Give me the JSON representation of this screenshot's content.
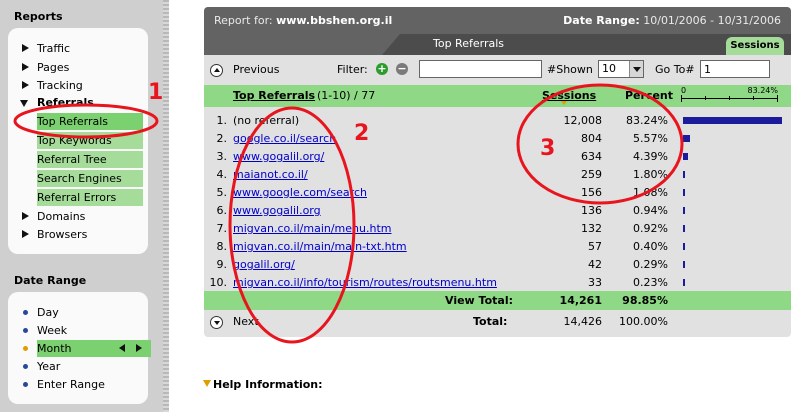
{
  "sidebar": {
    "reports_title": "Reports",
    "items": [
      {
        "label": "Traffic"
      },
      {
        "label": "Pages"
      },
      {
        "label": "Tracking"
      },
      {
        "label": "Referrals"
      },
      {
        "label": "Domains"
      },
      {
        "label": "Browsers"
      }
    ],
    "sub_items": [
      {
        "label": "Top Referrals"
      },
      {
        "label": "Top Keywords"
      },
      {
        "label": "Referral Tree"
      },
      {
        "label": "Search Engines"
      },
      {
        "label": "Referral Errors"
      }
    ],
    "date_range_title": "Date Range",
    "date_items": [
      {
        "label": "Day"
      },
      {
        "label": "Week"
      },
      {
        "label": "Month"
      },
      {
        "label": "Year"
      },
      {
        "label": "Enter Range"
      }
    ]
  },
  "report": {
    "report_for_label": "Report for:",
    "site": "www.bbshen.org.il",
    "date_range_label": "Date Range:",
    "date_range": "10/01/2006 - 10/31/2006",
    "tab_title": "Top Referrals",
    "sessions_tab": "Sessions"
  },
  "toolbar": {
    "previous": "Previous",
    "filter_label": "Filter:",
    "filter_value": "",
    "shown_label": "#Shown",
    "shown_value": "10",
    "goto_label": "Go To#",
    "goto_value": "1"
  },
  "table": {
    "col_referrals": "Top Referrals",
    "range_text": "(1-10) / 77",
    "col_sessions": "Sessions",
    "col_percent": "Percent",
    "scale_min": "0",
    "scale_max": "83.24%",
    "rows": [
      {
        "num": "1.",
        "referral": "(no referral)",
        "sessions": "12,008",
        "percent": "83.24%",
        "share": 0.8324
      },
      {
        "num": "2.",
        "referral": "google.co.il/search",
        "sessions": "804",
        "percent": "5.57%",
        "share": 0.0557
      },
      {
        "num": "3.",
        "referral": "www.gogalil.org/",
        "sessions": "634",
        "percent": "4.39%",
        "share": 0.0439
      },
      {
        "num": "4.",
        "referral": "maianot.co.il/",
        "sessions": "259",
        "percent": "1.80%",
        "share": 0.018
      },
      {
        "num": "5.",
        "referral": "www.google.com/search",
        "sessions": "156",
        "percent": "1.08%",
        "share": 0.0108
      },
      {
        "num": "6.",
        "referral": "www.gogalil.org",
        "sessions": "136",
        "percent": "0.94%",
        "share": 0.0094
      },
      {
        "num": "7.",
        "referral": "migvan.co.il/main/menu.htm",
        "sessions": "132",
        "percent": "0.92%",
        "share": 0.0092
      },
      {
        "num": "8.",
        "referral": "migvan.co.il/main/main-txt.htm",
        "sessions": "57",
        "percent": "0.40%",
        "share": 0.004
      },
      {
        "num": "9.",
        "referral": "gogalil.org/",
        "sessions": "42",
        "percent": "0.29%",
        "share": 0.0029
      },
      {
        "num": "10.",
        "referral": "migvan.co.il/info/tourism/routes/routsmenu.htm",
        "sessions": "33",
        "percent": "0.23%",
        "share": 0.0023
      }
    ],
    "view_total_label": "View Total:",
    "view_total_sessions": "14,261",
    "view_total_percent": "98.85%",
    "next": "Next",
    "total_label": "Total:",
    "total_sessions": "14,426",
    "total_percent": "100.00%"
  },
  "help": {
    "label": "Help Information:"
  },
  "annotations": {
    "n1": "1",
    "n2": "2",
    "n3": "3",
    "color": "#e8141e"
  },
  "colors": {
    "green": "#8fd885",
    "header": "#636363",
    "bar": "#1b1b9b",
    "link": "#0000cc"
  }
}
